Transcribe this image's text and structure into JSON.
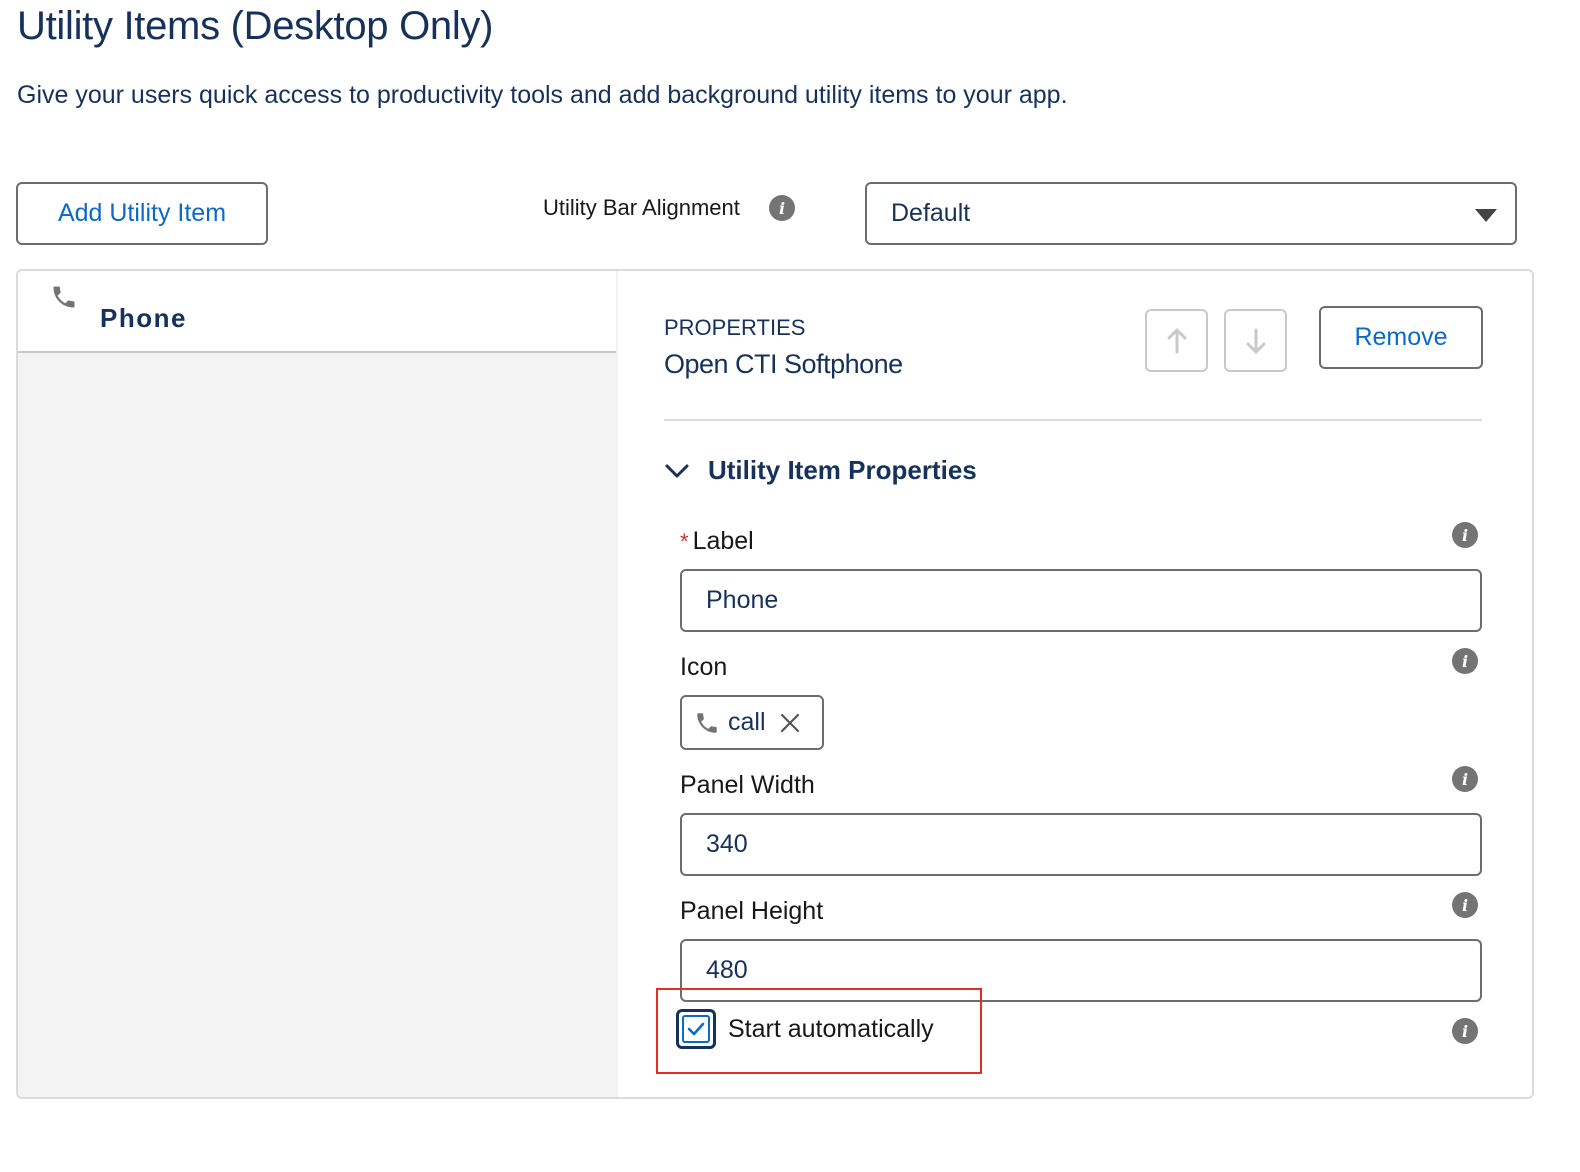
{
  "header": {
    "title": "Utility Items (Desktop Only)",
    "description": "Give your users quick access to productivity tools and add background utility items to your app."
  },
  "toolbar": {
    "add_label": "Add Utility Item",
    "alignment_label": "Utility Bar Alignment",
    "alignment_value": "Default"
  },
  "utility_list": {
    "items": [
      {
        "label": "Phone",
        "icon": "phone-icon"
      }
    ]
  },
  "properties": {
    "heading": "PROPERTIES",
    "subtitle": "Open CTI Softphone",
    "remove_label": "Remove",
    "section_title": "Utility Item Properties",
    "fields": {
      "label": {
        "label": "Label",
        "required_mark": "*",
        "value": "Phone"
      },
      "icon": {
        "label": "Icon",
        "value": "call"
      },
      "panel_width": {
        "label": "Panel Width",
        "value": "340"
      },
      "panel_height": {
        "label": "Panel Height",
        "value": "480"
      },
      "start_automatically": {
        "label": "Start automatically",
        "checked": true
      }
    }
  },
  "colors": {
    "brand_blue": "#0b6ac9",
    "text_navy": "#16325c",
    "highlight_red": "#e0301e"
  }
}
